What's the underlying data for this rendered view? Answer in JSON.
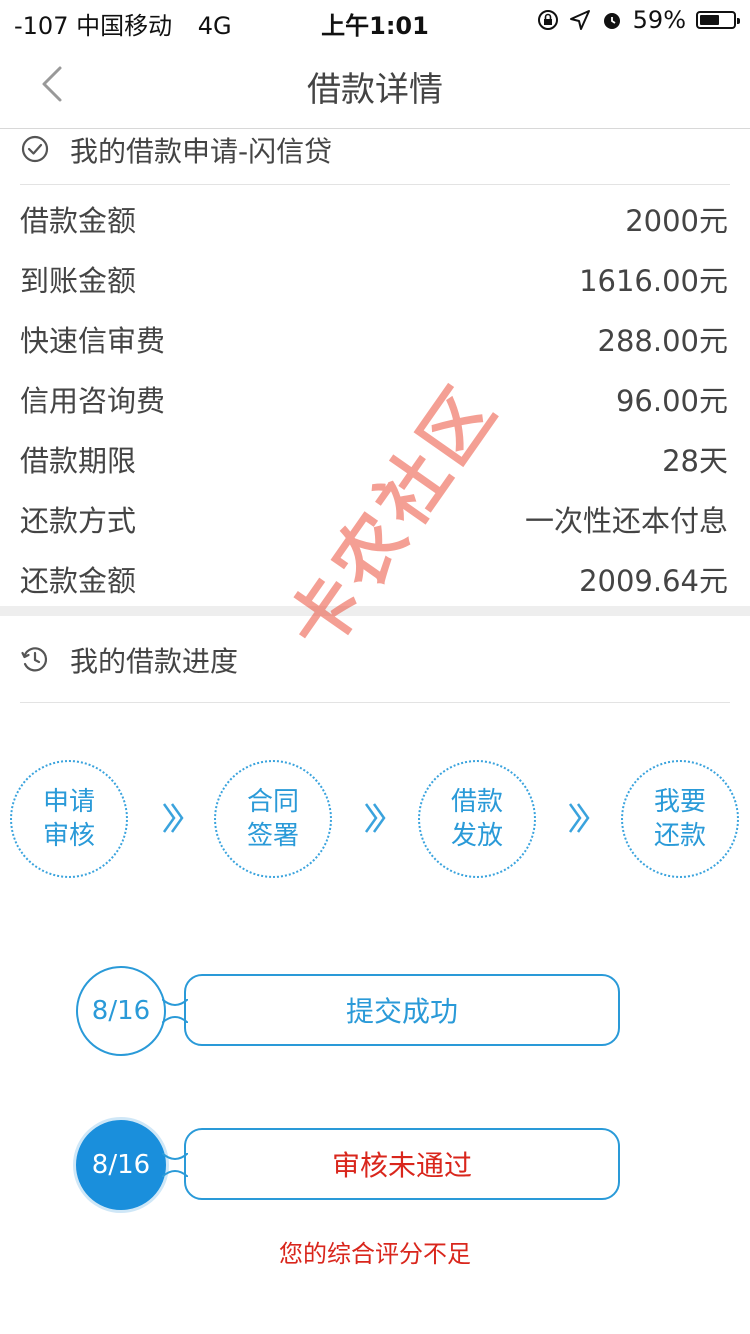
{
  "status_bar": {
    "carrier": "-107 中国移动",
    "network": "4G",
    "time": "上午1:01",
    "battery_percent": "59%",
    "battery_level": 0.59
  },
  "nav": {
    "title": "借款详情"
  },
  "application": {
    "title": "我的借款申请-闪信贷",
    "rows": [
      {
        "label": "借款金额",
        "value": "2000元"
      },
      {
        "label": "到账金额",
        "value": "1616.00元"
      },
      {
        "label": "快速信审费",
        "value": "288.00元"
      },
      {
        "label": "信用咨询费",
        "value": "96.00元"
      },
      {
        "label": "借款期限",
        "value": "28天"
      },
      {
        "label": "还款方式",
        "value": "一次性还本付息"
      },
      {
        "label": "还款金额",
        "value": "2009.64元"
      }
    ]
  },
  "progress": {
    "title": "我的借款进度",
    "steps": [
      {
        "line1": "申请",
        "line2": "审核"
      },
      {
        "line1": "合同",
        "line2": "签署"
      },
      {
        "line1": "借款",
        "line2": "发放"
      },
      {
        "line1": "我要",
        "line2": "还款"
      }
    ],
    "timeline": [
      {
        "date": "8/16",
        "status": "提交成功"
      },
      {
        "date": "8/16",
        "status": "审核未通过"
      }
    ],
    "note": "您的综合评分不足"
  },
  "watermark": "卡农社区",
  "colors": {
    "accent": "#2a9ad8",
    "error": "#d9261c"
  }
}
